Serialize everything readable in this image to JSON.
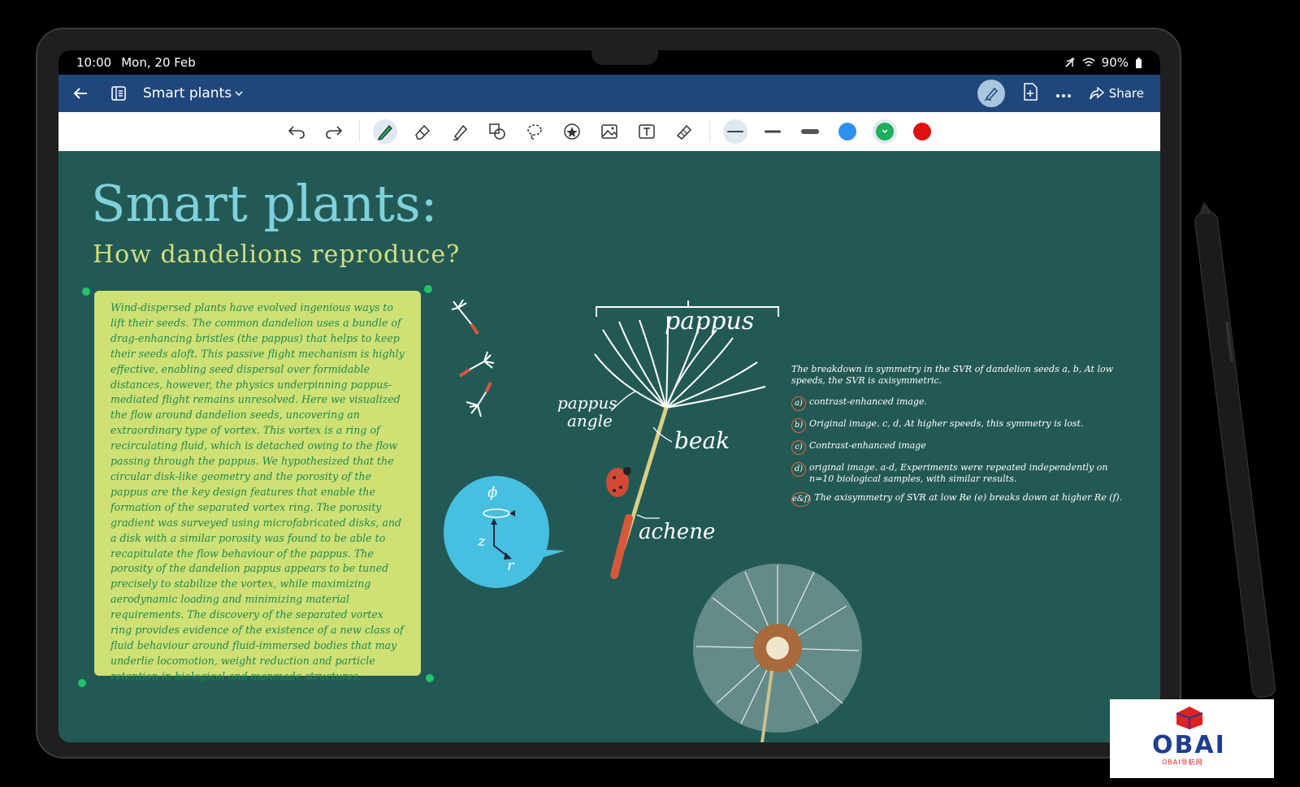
{
  "status_bar": {
    "time": "10:00",
    "date": "Mon, 20 Feb",
    "battery": "90%"
  },
  "app_bar": {
    "title": "Smart plants",
    "share_label": "Share"
  },
  "toolbar": {
    "tools": [
      "undo-icon",
      "redo-icon",
      "pen-icon",
      "eraser-icon",
      "highlighter-icon",
      "shapes-icon",
      "lasso-icon",
      "sticker-icon",
      "image-icon",
      "text-box-icon",
      "tape-icon"
    ],
    "colors": [
      "#2f8ff0",
      "#1fae5b",
      "#e01010"
    ]
  },
  "note": {
    "title": "Smart plants:",
    "subtitle": "How dandelions reproduce?",
    "body": "Wind-dispersed plants have evolved ingenious ways to lift their seeds. The common dandelion uses a bundle of drag-enhancing bristles (the pappus) that helps to keep their seeds aloft. This passive flight mechanism is highly effective, enabling seed dispersal over formidable distances, however, the physics underpinning pappus-mediated flight remains unresolved. Here we visualized the flow around dandelion seeds, uncovering an extraordinary type of vortex. This vortex is a ring of recirculating fluid, which is detached owing to the flow passing through the pappus. We hypothesized that the circular disk-like geometry and the porosity of the pappus are the key design features that enable the formation of the separated vortex ring. The porosity gradient was surveyed using microfabricated disks, and a disk with a similar porosity was found to be able to recapitulate the flow behaviour of the pappus. The porosity of the dandelion pappus appears to be tuned precisely to stabilize the vortex, while maximizing aerodynamic loading and minimizing material requirements. The discovery of the separated vortex ring provides evidence of the existence of a new class of fluid behaviour around fluid-immersed bodies that may underlie locomotion, weight reduction and particle retention in biological and manmade structures."
  },
  "diagram": {
    "pappus": "pappus",
    "pappus_angle_1": "pappus",
    "pappus_angle_2": "angle",
    "beak": "beak",
    "achene": "achene",
    "phi": "ϕ",
    "z": "z",
    "r": "r"
  },
  "annotations": {
    "intro": "The breakdown in symmetry in the SVR of dandelion seeds a, b, At low speeds, the SVR is axisymmetric.",
    "items": [
      {
        "tag": "a)",
        "text": "contrast-enhanced image."
      },
      {
        "tag": "b)",
        "text": "Original image. c, d, At higher speeds, this symmetry is lost."
      },
      {
        "tag": "c)",
        "text": "Contrast-enhanced image"
      },
      {
        "tag": "d)",
        "text": "original image. a-d, Experiments were repeated independently on n=10 biological samples, with similar results."
      },
      {
        "tag": "e&f)",
        "text": "The axisymmetry of SVR at low Re (e) breaks down at higher Re (f)."
      }
    ]
  },
  "logo": {
    "text": "OBAI",
    "sub": "OBAI导航网"
  }
}
